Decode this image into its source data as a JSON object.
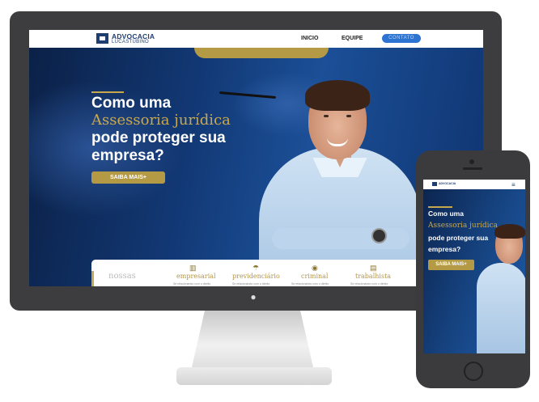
{
  "nav": {
    "logo_line1": "ADVOCACIA",
    "logo_line2": "LUCASTUBINO",
    "links": [
      "INICIO",
      "EQUIPE"
    ],
    "cta": "CONTATO"
  },
  "hero": {
    "line1": "Como uma",
    "highlight": "Assessoria jurídica",
    "line3": "pode proteger sua",
    "line4": "empresa?",
    "button": "SAIBA MAIS+"
  },
  "services": {
    "heading": "nossas",
    "items": [
      {
        "title": "empresarial",
        "desc": "Se relacionando com o direito",
        "icon": "building-icon"
      },
      {
        "title": "previdenciário",
        "desc": "Se relacionando com o direito",
        "icon": "umbrella-icon"
      },
      {
        "title": "criminal",
        "desc": "Se relacionando com o direito",
        "icon": "eye-icon"
      },
      {
        "title": "trabalhista",
        "desc": "Se relacionando com o direito",
        "icon": "briefcase-icon"
      }
    ]
  },
  "device_icon": "apple-logo",
  "phone": {
    "hero_line1": "Como uma",
    "hero_highlight": "Assessoria jurídica",
    "hero_line3": "pode proteger sua",
    "hero_line4": "empresa?",
    "button": "SAIBA MAIS+"
  },
  "colors": {
    "gold": "#b49a45",
    "navy": "#123874",
    "cta_blue": "#2c73d2"
  }
}
